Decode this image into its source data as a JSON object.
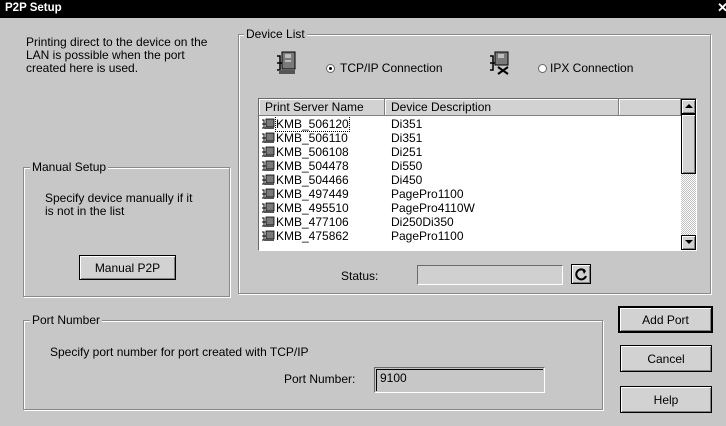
{
  "window": {
    "title": "P2P Setup",
    "close_glyph": "✕"
  },
  "intro_text": [
    "Printing direct to the device on the",
    "LAN is possible when the port",
    "created here is used."
  ],
  "manual_setup": {
    "legend": "Manual Setup",
    "text": [
      "Specify device manually if it",
      "is not in the list"
    ],
    "button_label": "Manual P2P"
  },
  "device_list": {
    "legend": "Device List",
    "tcpip_label": "TCP/IP Connection",
    "ipx_label": "IPX Connection",
    "selected": "tcpip",
    "columns": [
      "Print Server Name",
      "Device Description"
    ],
    "rows": [
      {
        "name": "KMB_506120",
        "desc": "Di351"
      },
      {
        "name": "KMB_506110",
        "desc": "Di351"
      },
      {
        "name": "KMB_506108",
        "desc": "Di251"
      },
      {
        "name": "KMB_504478",
        "desc": "Di550"
      },
      {
        "name": "KMB_504466",
        "desc": "Di450"
      },
      {
        "name": "KMB_497449",
        "desc": "PagePro1100"
      },
      {
        "name": "KMB_495510",
        "desc": "PagePro4110W"
      },
      {
        "name": "KMB_477106",
        "desc": "Di250Di350"
      },
      {
        "name": "KMB_475862",
        "desc": "PagePro1100"
      }
    ],
    "status_label": "Status:",
    "status_value": ""
  },
  "port_number": {
    "legend": "Port Number",
    "text": "Specify port number for port created with TCP/IP",
    "label": "Port Number:",
    "value": "9100"
  },
  "buttons": {
    "add_port": "Add Port",
    "cancel": "Cancel",
    "help": "Help"
  },
  "icons": {
    "refresh": "refresh-icon",
    "printer": "network-printer-icon",
    "close": "close-icon"
  }
}
